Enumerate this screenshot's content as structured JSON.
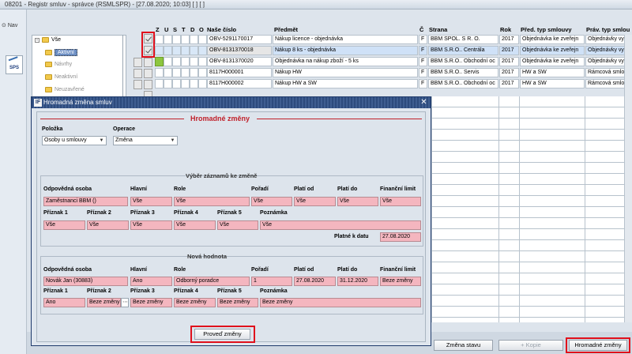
{
  "window": {
    "title": "08201 - Registr smluv - správce (RSMLSPR) - [27.08.2020; 10:03] [ ] [ ]",
    "nav_label": "Nav",
    "sps_label": "SPS"
  },
  "tree": {
    "items": [
      "Vše",
      "Aktivní",
      "Návrhy",
      "Neaktivní",
      "Neuzavřené"
    ]
  },
  "grid": {
    "flag_headers": [
      "Z",
      "U",
      "S",
      "T",
      "D",
      "O"
    ],
    "headers": {
      "nase_cislo": "Naše číslo",
      "predmet": "Předmět",
      "c": "Č",
      "strana": "Strana",
      "rok": "Rok",
      "pred_typ": "Před. typ smlouvy",
      "prav_typ": "Práv. typ smlou"
    },
    "rows": [
      {
        "nase_cislo": "OBV-5291170017",
        "predmet": "Nákup licence - objednávka",
        "c": "F",
        "strana": "BBM SPOL. S R. O.",
        "rok": "2017",
        "pred_typ": "Objednávka ke zveřejn",
        "prav_typ": "Objednávky vys",
        "checked": true
      },
      {
        "nase_cislo": "OBV-8131370018",
        "predmet": "Nákup 8 ks - objednávka",
        "c": "F",
        "strana": "BBM S.R.O.. Centrála",
        "rok": "2017",
        "pred_typ": "Objednávka ke zveřejn",
        "prav_typ": "Objednávky vys",
        "checked": true
      },
      {
        "nase_cislo": "OBV-8131370020",
        "predmet": "Objednávka na nákup zboží - 5 ks",
        "c": "F",
        "strana": "BBM S.R.O.. Obchodní oc",
        "rok": "2017",
        "pred_typ": "Objednávka ke zveřejn",
        "prav_typ": "Objednávky vys",
        "checked": false
      },
      {
        "nase_cislo": "8117H000001",
        "predmet": "Nákup HW",
        "c": "F",
        "strana": "BBM S.R.O.. Servis",
        "rok": "2017",
        "pred_typ": "HW a SW",
        "prav_typ": "Rámcová smlouv",
        "checked": false
      },
      {
        "nase_cislo": "8117H000002",
        "predmet": "Nákup HW a SW",
        "c": "F",
        "strana": "BBM S.R.O.. Obchodní oc",
        "rok": "2017",
        "pred_typ": "HW a SW",
        "prav_typ": "Rámcová smlouv",
        "checked": false
      }
    ]
  },
  "dialog": {
    "title": "Hromadná změna smluv",
    "logo": "IF",
    "heading": "Hromadné změny",
    "polozka_label": "Položka",
    "polozka_value": "Osoby u smlouvy",
    "operace_label": "Operace",
    "operace_value": "Změna",
    "vyber": {
      "title": "Výběr záznamů ke změně",
      "labels1": [
        "Odpovědná osoba",
        "Hlavní",
        "Role",
        "Pořadí",
        "Platí od",
        "Platí do",
        "Finanční limit"
      ],
      "values1": [
        "Zaměstnanci BBM ()",
        "Vše",
        "Vše",
        "Vše",
        "Vše",
        "Vše",
        "Vše"
      ],
      "labels2": [
        "Příznak 1",
        "Příznak 2",
        "Příznak 3",
        "Příznak 4",
        "Příznak 5",
        "Poznámka"
      ],
      "values2": [
        "Vše",
        "Vše",
        "Vše",
        "Vše",
        "Vše",
        "Vše"
      ],
      "platne_label": "Platné k datu",
      "platne_value": "27.08.2020"
    },
    "nova": {
      "title": "Nová hodnota",
      "labels1": [
        "Odpovědná osoba",
        "Hlavní",
        "Role",
        "Pořadí",
        "Platí od",
        "Platí do",
        "Finanční limit"
      ],
      "values1": [
        "Novák Jan (30883)",
        "Ano",
        "Odborný poradce",
        "1",
        "27.08.2020",
        "31.12.2020",
        "Beze změny"
      ],
      "labels2": [
        "Příznak 1",
        "Příznak 2",
        "Příznak 3",
        "Příznak 4",
        "Příznak 5",
        "Poznámka"
      ],
      "values2": [
        "Ano",
        "Beze změny",
        "Beze změny",
        "Beze změny",
        "Beze změny",
        "Beze změny"
      ]
    },
    "submit_label": "Proveď změny"
  },
  "bottom": {
    "zmena_stavu": "Změna stavu",
    "kopie": "+ Kopie",
    "hromadne": "Hromadné změny"
  }
}
